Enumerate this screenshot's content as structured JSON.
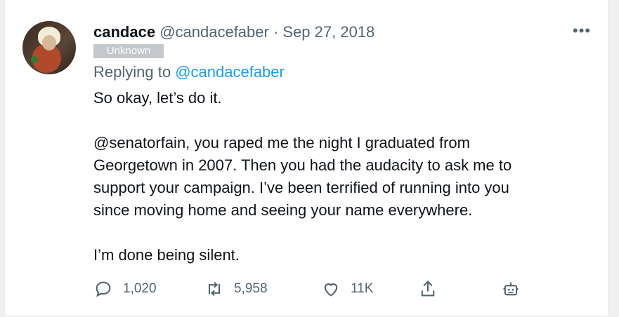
{
  "tweet": {
    "display_name": "candace",
    "handle_date": "@candacefaber · Sep 27, 2018",
    "badge": "Unknown",
    "replying_prefix": "Replying to",
    "replying_handle": "@candacefaber",
    "body": [
      "So okay, let’s do it.",
      "@senatorfain, you raped me the night I graduated from",
      "Georgetown in 2007. Then you had the audacity to ask me to",
      "support your campaign. I’ve been terrified of running into you",
      "since moving home and seeing your name everywhere.",
      "I’m done being silent."
    ],
    "more_icon": "more-horizontal-icon"
  },
  "actions": {
    "reply": {
      "icon": "reply-icon",
      "count": "1,020"
    },
    "retweet": {
      "icon": "retweet-icon",
      "count": "5,958"
    },
    "like": {
      "icon": "heart-icon",
      "count": "11K"
    },
    "share": {
      "icon": "share-icon"
    },
    "bot": {
      "icon": "robot-icon"
    }
  },
  "colors": {
    "link": "#1d9bf0",
    "muted": "#536471",
    "badge_bg": "#c4c8cc"
  }
}
